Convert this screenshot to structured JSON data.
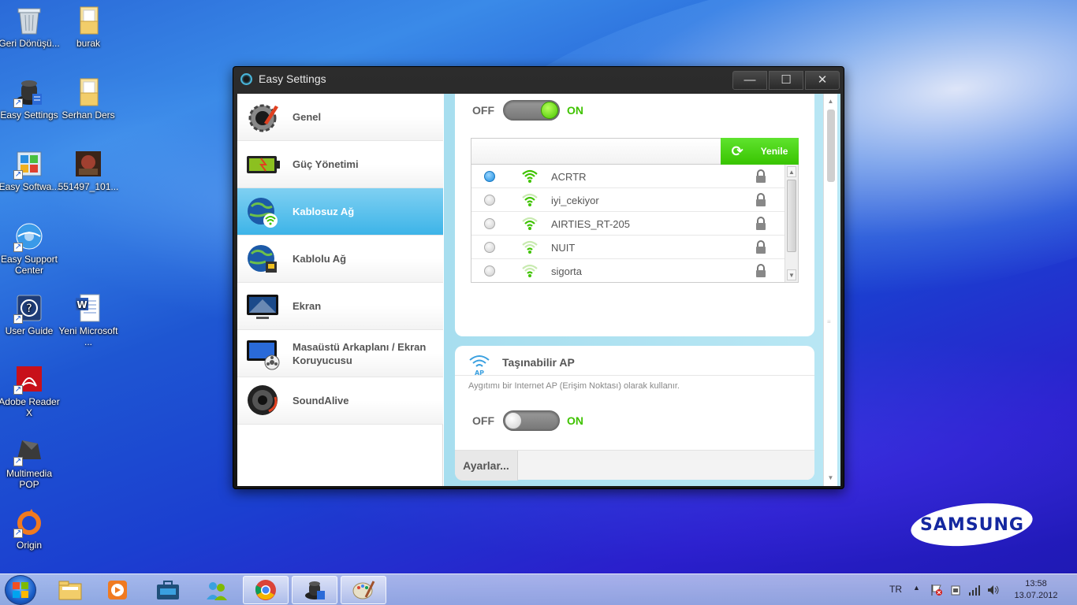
{
  "desktop": {
    "icons": [
      {
        "label": "Geri Dönüşü...",
        "icon": "recycle-bin-icon"
      },
      {
        "label": "burak",
        "icon": "folder-icon"
      },
      {
        "label": "Easy Settings",
        "icon": "easy-settings-icon"
      },
      {
        "label": "Serhan Ders",
        "icon": "folder-icon"
      },
      {
        "label": "Easy Softwa...",
        "icon": "easy-software-icon"
      },
      {
        "label": "551497_101...",
        "icon": "image-file-icon"
      },
      {
        "label": "Easy Support Center",
        "icon": "easy-support-icon"
      },
      {
        "label": "User Guide",
        "icon": "user-guide-icon"
      },
      {
        "label": "Yeni Microsoft ...",
        "icon": "word-document-icon"
      },
      {
        "label": "Adobe Reader X",
        "icon": "adobe-reader-icon"
      },
      {
        "label": "Multimedia POP",
        "icon": "multimedia-pop-icon"
      },
      {
        "label": "Origin",
        "icon": "origin-icon"
      }
    ],
    "brand_logo": "SAMSUNG"
  },
  "window": {
    "title": "Easy Settings",
    "controls": {
      "minimize": "—",
      "maximize": "☐",
      "close": "✕"
    }
  },
  "sidebar": {
    "items": [
      {
        "label": "Genel",
        "icon": "general-settings-icon"
      },
      {
        "label": "Güç Yönetimi",
        "icon": "battery-icon"
      },
      {
        "label": "Kablosuz Ağ",
        "icon": "wireless-globe-icon",
        "active": true
      },
      {
        "label": "Kablolu Ağ",
        "icon": "wired-globe-icon"
      },
      {
        "label": "Ekran",
        "icon": "display-icon"
      },
      {
        "label": "Masaüstü Arkaplanı / Ekran Koruyucusu",
        "icon": "wallpaper-icon"
      },
      {
        "label": "SoundAlive",
        "icon": "speaker-icon"
      }
    ]
  },
  "wifi_panel": {
    "off_label": "OFF",
    "on_label": "ON",
    "toggle_state": "on",
    "refresh_label": "Yenile",
    "networks": [
      {
        "ssid": "ACRTR",
        "selected": true,
        "locked": true
      },
      {
        "ssid": "iyi_cekiyor",
        "selected": false,
        "locked": true
      },
      {
        "ssid": "AIRTIES_RT-205",
        "selected": false,
        "locked": true
      },
      {
        "ssid": "NUIT",
        "selected": false,
        "locked": true
      },
      {
        "ssid": "sigorta",
        "selected": false,
        "locked": true
      }
    ]
  },
  "ap_panel": {
    "icon_label": "AP",
    "title": "Taşınabilir AP",
    "description": "Aygıtımı bir Internet AP (Erişim Noktası) olarak kullanır.",
    "off_label": "OFF",
    "on_label": "ON",
    "toggle_state": "off",
    "settings_label": "Ayarlar..."
  },
  "taskbar": {
    "language": "TR",
    "time": "13:58",
    "date": "13.07.2012",
    "pinned": [
      "explorer-icon",
      "media-player-icon",
      "briefcase-icon",
      "people-icon",
      "chrome-icon",
      "easy-settings-icon",
      "paint-icon"
    ]
  },
  "colors": {
    "accent_green": "#3fc300",
    "active_nav": "#3db4e8",
    "selected_radio": "#1c8de0"
  }
}
